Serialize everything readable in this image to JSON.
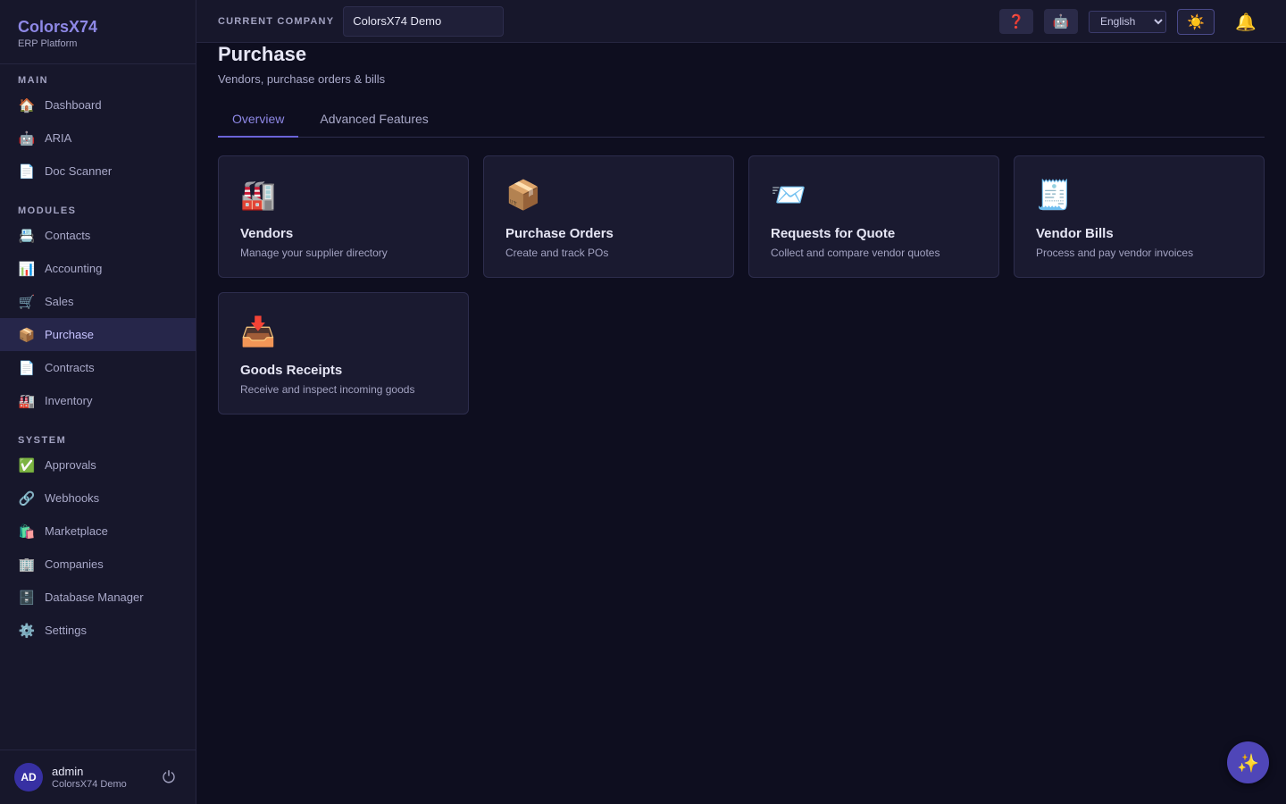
{
  "brand": {
    "name": "ColorsX74",
    "subtitle": "ERP Platform"
  },
  "sidebar": {
    "main": {
      "title": "MAIN",
      "items": [
        {
          "icon": "🏠",
          "icon_name": "home-icon",
          "label": "Dashboard"
        },
        {
          "icon": "🤖",
          "icon_name": "robot-icon",
          "label": "ARIA"
        },
        {
          "icon": "📄",
          "icon_name": "document-icon",
          "label": "Doc Scanner"
        }
      ]
    },
    "modules": {
      "title": "MODULES",
      "items": [
        {
          "icon": "📇",
          "icon_name": "card-index-icon",
          "label": "Contacts"
        },
        {
          "icon": "📊",
          "icon_name": "bar-chart-icon",
          "label": "Accounting"
        },
        {
          "icon": "🛒",
          "icon_name": "shopping-cart-icon",
          "label": "Sales"
        },
        {
          "icon": "📦",
          "icon_name": "package-icon",
          "label": "Purchase",
          "active": true
        },
        {
          "icon": "📄",
          "icon_name": "document-icon",
          "label": "Contracts"
        },
        {
          "icon": "🏭",
          "icon_name": "factory-icon",
          "label": "Inventory"
        }
      ]
    },
    "system": {
      "title": "SYSTEM",
      "items": [
        {
          "icon": "✅",
          "icon_name": "check-mark-icon",
          "label": "Approvals"
        },
        {
          "icon": "🔗",
          "icon_name": "link-icon",
          "label": "Webhooks"
        },
        {
          "icon": "🛍️",
          "icon_name": "shopping-bags-icon",
          "label": "Marketplace"
        },
        {
          "icon": "🏢",
          "icon_name": "office-building-icon",
          "label": "Companies"
        },
        {
          "icon": "🗄️",
          "icon_name": "file-cabinet-icon",
          "label": "Database Manager"
        },
        {
          "icon": "⚙️",
          "icon_name": "gear-icon",
          "label": "Settings"
        }
      ]
    }
  },
  "user": {
    "initials": "AD",
    "name": "admin",
    "company": "ColorsX74 Demo",
    "logout_icon": "⏻"
  },
  "topbar": {
    "company_label": "CURRENT COMPANY",
    "company_value": "ColorsX74 Demo",
    "help_icon": "❓",
    "robot_icon": "🤖",
    "language": "English",
    "theme_icon": "☀️",
    "bell_icon": "🔔"
  },
  "page": {
    "title": "Purchase",
    "subtitle": "Vendors, purchase orders & bills",
    "tabs": [
      {
        "label": "Overview",
        "active": true
      },
      {
        "label": "Advanced Features"
      }
    ],
    "cards": [
      {
        "icon": "🏭",
        "icon_name": "factory-icon",
        "title": "Vendors",
        "description": "Manage your supplier directory"
      },
      {
        "icon": "📦",
        "icon_name": "package-icon",
        "title": "Purchase Orders",
        "description": "Create and track POs"
      },
      {
        "icon": "📨",
        "icon_name": "incoming-envelope-icon",
        "title": "Requests for Quote",
        "description": "Collect and compare vendor quotes"
      },
      {
        "icon": "🧾",
        "icon_name": "receipt-icon",
        "title": "Vendor Bills",
        "description": "Process and pay vendor invoices"
      },
      {
        "icon": "📥",
        "icon_name": "inbox-tray-icon",
        "title": "Goods Receipts",
        "description": "Receive and inspect incoming goods"
      }
    ]
  },
  "fab_icon": "✨",
  "colors": {
    "accent": "#8e88e6",
    "background": "#0e0e1f",
    "sidebar": "#17172b",
    "fab": "#4f46b8"
  }
}
